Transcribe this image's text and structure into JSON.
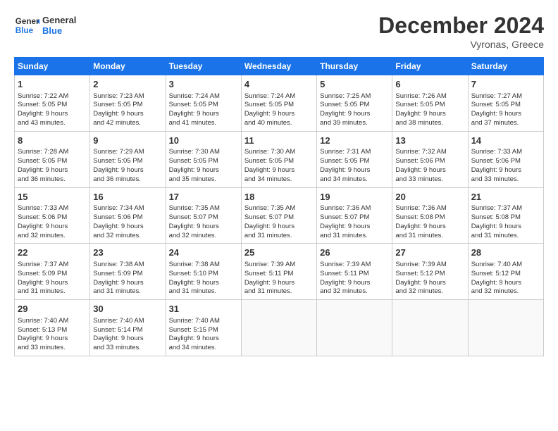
{
  "header": {
    "logo_line1": "General",
    "logo_line2": "Blue",
    "month": "December 2024",
    "location": "Vyronas, Greece"
  },
  "weekdays": [
    "Sunday",
    "Monday",
    "Tuesday",
    "Wednesday",
    "Thursday",
    "Friday",
    "Saturday"
  ],
  "weeks": [
    [
      {
        "day": "1",
        "info": "Sunrise: 7:22 AM\nSunset: 5:05 PM\nDaylight: 9 hours\nand 43 minutes."
      },
      {
        "day": "2",
        "info": "Sunrise: 7:23 AM\nSunset: 5:05 PM\nDaylight: 9 hours\nand 42 minutes."
      },
      {
        "day": "3",
        "info": "Sunrise: 7:24 AM\nSunset: 5:05 PM\nDaylight: 9 hours\nand 41 minutes."
      },
      {
        "day": "4",
        "info": "Sunrise: 7:24 AM\nSunset: 5:05 PM\nDaylight: 9 hours\nand 40 minutes."
      },
      {
        "day": "5",
        "info": "Sunrise: 7:25 AM\nSunset: 5:05 PM\nDaylight: 9 hours\nand 39 minutes."
      },
      {
        "day": "6",
        "info": "Sunrise: 7:26 AM\nSunset: 5:05 PM\nDaylight: 9 hours\nand 38 minutes."
      },
      {
        "day": "7",
        "info": "Sunrise: 7:27 AM\nSunset: 5:05 PM\nDaylight: 9 hours\nand 37 minutes."
      }
    ],
    [
      {
        "day": "8",
        "info": "Sunrise: 7:28 AM\nSunset: 5:05 PM\nDaylight: 9 hours\nand 36 minutes."
      },
      {
        "day": "9",
        "info": "Sunrise: 7:29 AM\nSunset: 5:05 PM\nDaylight: 9 hours\nand 36 minutes."
      },
      {
        "day": "10",
        "info": "Sunrise: 7:30 AM\nSunset: 5:05 PM\nDaylight: 9 hours\nand 35 minutes."
      },
      {
        "day": "11",
        "info": "Sunrise: 7:30 AM\nSunset: 5:05 PM\nDaylight: 9 hours\nand 34 minutes."
      },
      {
        "day": "12",
        "info": "Sunrise: 7:31 AM\nSunset: 5:05 PM\nDaylight: 9 hours\nand 34 minutes."
      },
      {
        "day": "13",
        "info": "Sunrise: 7:32 AM\nSunset: 5:06 PM\nDaylight: 9 hours\nand 33 minutes."
      },
      {
        "day": "14",
        "info": "Sunrise: 7:33 AM\nSunset: 5:06 PM\nDaylight: 9 hours\nand 33 minutes."
      }
    ],
    [
      {
        "day": "15",
        "info": "Sunrise: 7:33 AM\nSunset: 5:06 PM\nDaylight: 9 hours\nand 32 minutes."
      },
      {
        "day": "16",
        "info": "Sunrise: 7:34 AM\nSunset: 5:06 PM\nDaylight: 9 hours\nand 32 minutes."
      },
      {
        "day": "17",
        "info": "Sunrise: 7:35 AM\nSunset: 5:07 PM\nDaylight: 9 hours\nand 32 minutes."
      },
      {
        "day": "18",
        "info": "Sunrise: 7:35 AM\nSunset: 5:07 PM\nDaylight: 9 hours\nand 31 minutes."
      },
      {
        "day": "19",
        "info": "Sunrise: 7:36 AM\nSunset: 5:07 PM\nDaylight: 9 hours\nand 31 minutes."
      },
      {
        "day": "20",
        "info": "Sunrise: 7:36 AM\nSunset: 5:08 PM\nDaylight: 9 hours\nand 31 minutes."
      },
      {
        "day": "21",
        "info": "Sunrise: 7:37 AM\nSunset: 5:08 PM\nDaylight: 9 hours\nand 31 minutes."
      }
    ],
    [
      {
        "day": "22",
        "info": "Sunrise: 7:37 AM\nSunset: 5:09 PM\nDaylight: 9 hours\nand 31 minutes."
      },
      {
        "day": "23",
        "info": "Sunrise: 7:38 AM\nSunset: 5:09 PM\nDaylight: 9 hours\nand 31 minutes."
      },
      {
        "day": "24",
        "info": "Sunrise: 7:38 AM\nSunset: 5:10 PM\nDaylight: 9 hours\nand 31 minutes."
      },
      {
        "day": "25",
        "info": "Sunrise: 7:39 AM\nSunset: 5:11 PM\nDaylight: 9 hours\nand 31 minutes."
      },
      {
        "day": "26",
        "info": "Sunrise: 7:39 AM\nSunset: 5:11 PM\nDaylight: 9 hours\nand 32 minutes."
      },
      {
        "day": "27",
        "info": "Sunrise: 7:39 AM\nSunset: 5:12 PM\nDaylight: 9 hours\nand 32 minutes."
      },
      {
        "day": "28",
        "info": "Sunrise: 7:40 AM\nSunset: 5:12 PM\nDaylight: 9 hours\nand 32 minutes."
      }
    ],
    [
      {
        "day": "29",
        "info": "Sunrise: 7:40 AM\nSunset: 5:13 PM\nDaylight: 9 hours\nand 33 minutes."
      },
      {
        "day": "30",
        "info": "Sunrise: 7:40 AM\nSunset: 5:14 PM\nDaylight: 9 hours\nand 33 minutes."
      },
      {
        "day": "31",
        "info": "Sunrise: 7:40 AM\nSunset: 5:15 PM\nDaylight: 9 hours\nand 34 minutes."
      },
      {
        "day": "",
        "info": ""
      },
      {
        "day": "",
        "info": ""
      },
      {
        "day": "",
        "info": ""
      },
      {
        "day": "",
        "info": ""
      }
    ]
  ]
}
